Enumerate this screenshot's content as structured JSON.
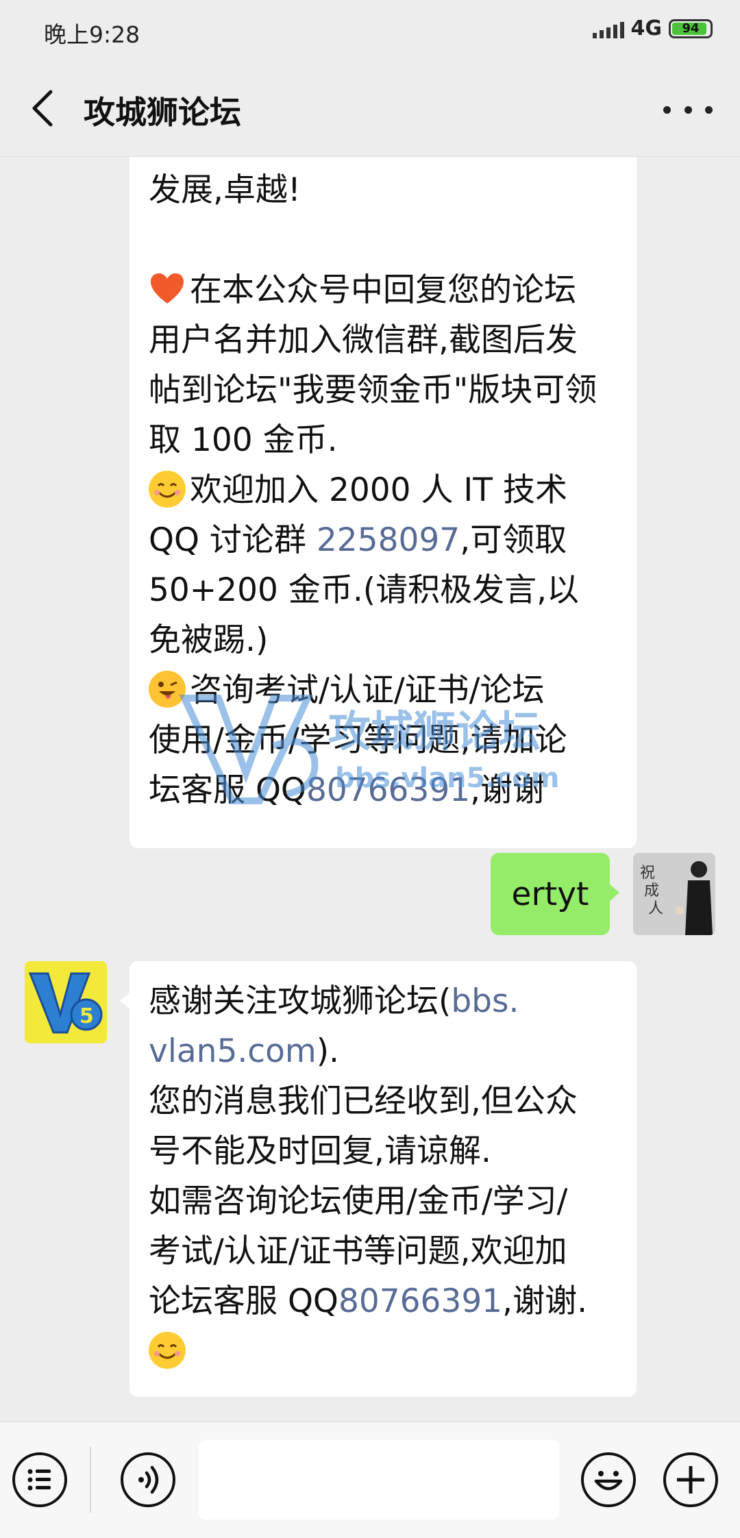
{
  "status": {
    "time": "晚上9:28",
    "network": "4G",
    "battery": "94"
  },
  "nav": {
    "title": "攻城狮论坛"
  },
  "messages": {
    "first": {
      "line1": "发展,卓越!",
      "line2": "在本公众号中回复您的论坛",
      "line3": "用户名并加入微信群,截图后发",
      "line4": "帖到论坛\"我要领金币\"版块可领",
      "line5": "取 100 金币.",
      "line6": "欢迎加入 2000 人 IT 技术",
      "line7a": "QQ 讨论群 ",
      "line7_link": "2258097",
      "line7b": ",可领取",
      "line8": "50+200 金币.(请积极发言,以",
      "line9": "免被踢.)",
      "line10": "咨询考试/认证/证书/论坛",
      "line11": "使用/金币/学习等问题,请加论",
      "line12a": "坛客服 QQ",
      "line12_link": "80766391",
      "line12b": ",谢谢"
    },
    "watermark": {
      "title": "攻城狮论坛",
      "url": "bbs.vlan5.com"
    },
    "sent": {
      "text": "ertyt"
    },
    "user_avatar_text": "祝成人",
    "reply": {
      "line1a": "感谢关注攻城狮论坛(",
      "line1_link": "bbs.",
      "line2_link": "vlan5.com",
      "line2b": ").",
      "line3": "您的消息我们已经收到,但公众",
      "line4": "号不能及时回复,请谅解.",
      "line5": "如需咨询论坛使用/金币/学习/",
      "line6": "考试/认证/证书等问题,欢迎加",
      "line7a": "论坛客服 QQ",
      "line7_link": "80766391",
      "line7b": ",谢谢."
    }
  },
  "icons": {
    "back": "chevron-left-icon",
    "more": "more-dots-icon",
    "menu": "list-menu-icon",
    "voice": "voice-icon",
    "emoji": "emoji-icon",
    "add": "plus-icon"
  },
  "colors": {
    "link": "#576b95",
    "sent_bubble": "#95ec69",
    "background": "#ededed"
  }
}
